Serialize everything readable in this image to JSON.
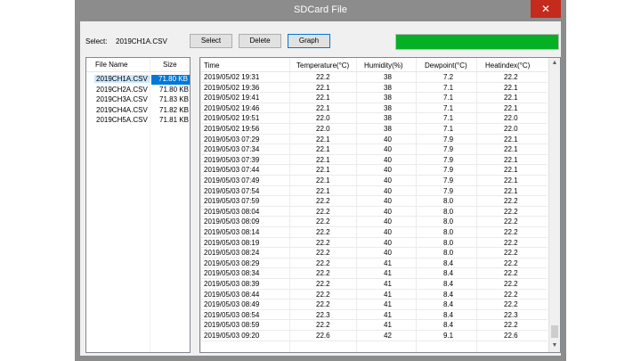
{
  "window": {
    "title": "SDCard File",
    "close_glyph": "✕"
  },
  "toolbar": {
    "select_label": "Select:",
    "selected_file": "2019CH1A.CSV",
    "select_button": "Select",
    "delete_button": "Delete",
    "graph_button": "Graph",
    "progress": 1.0,
    "progress_color": "#06b025"
  },
  "files": {
    "headers": {
      "name": "File Name",
      "size": "Size"
    },
    "rows": [
      {
        "name": "2019CH1A.CSV",
        "size": "71.80 KB"
      },
      {
        "name": "2019CH2A.CSV",
        "size": "71.80 KB"
      },
      {
        "name": "2019CH3A.CSV",
        "size": "71.83 KB"
      },
      {
        "name": "2019CH4A.CSV",
        "size": "71.82 KB"
      },
      {
        "name": "2019CH5A.CSV",
        "size": "71.81 KB"
      }
    ],
    "selected_index": 0
  },
  "table": {
    "headers": {
      "time": "Time",
      "temperature": "Temperature(°C)",
      "humidity": "Humidity(%)",
      "dewpoint": "Dewpoint(°C)",
      "heatindex": "Heatindex(°C)"
    },
    "rows": [
      [
        "2019/05/02 19:31",
        "22.2",
        "38",
        "7.2",
        "22.2"
      ],
      [
        "2019/05/02 19:36",
        "22.1",
        "38",
        "7.1",
        "22.1"
      ],
      [
        "2019/05/02 19:41",
        "22.1",
        "38",
        "7.1",
        "22.1"
      ],
      [
        "2019/05/02 19:46",
        "22.1",
        "38",
        "7.1",
        "22.1"
      ],
      [
        "2019/05/02 19:51",
        "22.0",
        "38",
        "7.1",
        "22.0"
      ],
      [
        "2019/05/02 19:56",
        "22.0",
        "38",
        "7.1",
        "22.0"
      ],
      [
        "2019/05/03 07:29",
        "22.1",
        "40",
        "7.9",
        "22.1"
      ],
      [
        "2019/05/03 07:34",
        "22.1",
        "40",
        "7.9",
        "22.1"
      ],
      [
        "2019/05/03 07:39",
        "22.1",
        "40",
        "7.9",
        "22.1"
      ],
      [
        "2019/05/03 07:44",
        "22.1",
        "40",
        "7.9",
        "22.1"
      ],
      [
        "2019/05/03 07:49",
        "22.1",
        "40",
        "7.9",
        "22.1"
      ],
      [
        "2019/05/03 07:54",
        "22.1",
        "40",
        "7.9",
        "22.1"
      ],
      [
        "2019/05/03 07:59",
        "22.2",
        "40",
        "8.0",
        "22.2"
      ],
      [
        "2019/05/03 08:04",
        "22.2",
        "40",
        "8.0",
        "22.2"
      ],
      [
        "2019/05/03 08:09",
        "22.2",
        "40",
        "8.0",
        "22.2"
      ],
      [
        "2019/05/03 08:14",
        "22.2",
        "40",
        "8.0",
        "22.2"
      ],
      [
        "2019/05/03 08:19",
        "22.2",
        "40",
        "8.0",
        "22.2"
      ],
      [
        "2019/05/03 08:24",
        "22.2",
        "40",
        "8.0",
        "22.2"
      ],
      [
        "2019/05/03 08:29",
        "22.2",
        "41",
        "8.4",
        "22.2"
      ],
      [
        "2019/05/03 08:34",
        "22.2",
        "41",
        "8.4",
        "22.2"
      ],
      [
        "2019/05/03 08:39",
        "22.2",
        "41",
        "8.4",
        "22.2"
      ],
      [
        "2019/05/03 08:44",
        "22.2",
        "41",
        "8.4",
        "22.2"
      ],
      [
        "2019/05/03 08:49",
        "22.2",
        "41",
        "8.4",
        "22.2"
      ],
      [
        "2019/05/03 08:54",
        "22.3",
        "41",
        "8.4",
        "22.3"
      ],
      [
        "2019/05/03 08:59",
        "22.2",
        "41",
        "8.4",
        "22.2"
      ],
      [
        "2019/05/03 09:20",
        "22.6",
        "42",
        "9.1",
        "22.6"
      ]
    ]
  },
  "scrollbar": {
    "up_glyph": "▲",
    "down_glyph": "▼"
  }
}
